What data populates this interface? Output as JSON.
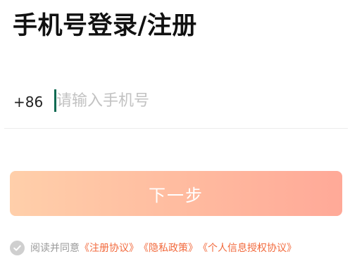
{
  "header": {
    "title": "手机号登录/注册"
  },
  "phone": {
    "country_code": "+86",
    "value": "",
    "placeholder": "请输入手机号"
  },
  "actions": {
    "next_label": "下一步"
  },
  "agreement": {
    "checked": false,
    "prefix": "阅读并同意",
    "links": [
      "《注册协议》",
      "《隐私政策》",
      "《个人信息授权协议》"
    ]
  },
  "colors": {
    "caret": "#0d6a52",
    "link": "#f26a3d",
    "button_gradient_start": "#ffcfaa",
    "button_gradient_end": "#ffa998",
    "checkbox": "#cfcfcf"
  },
  "icons": {
    "checkbox": "check-circle-icon"
  }
}
